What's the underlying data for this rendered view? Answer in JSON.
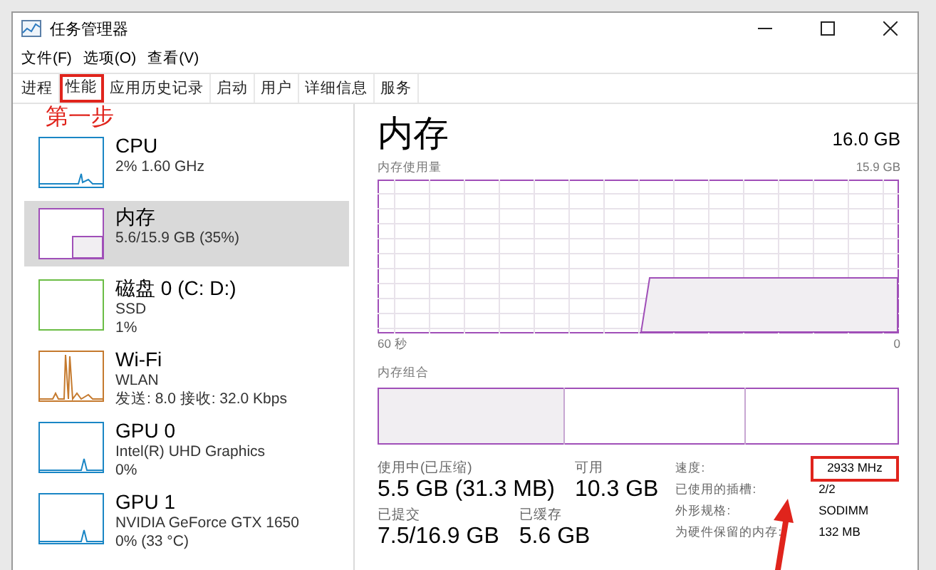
{
  "window": {
    "title": "任务管理器"
  },
  "menu": [
    "文件(F)",
    "选项(O)",
    "查看(V)"
  ],
  "tabs": [
    {
      "label": "进程",
      "selected": false,
      "boxed": false
    },
    {
      "label": "性能",
      "selected": true,
      "boxed": true
    },
    {
      "label": "应用历史记录",
      "selected": false,
      "boxed": false
    },
    {
      "label": "启动",
      "selected": false,
      "boxed": false
    },
    {
      "label": "用户",
      "selected": false,
      "boxed": false
    },
    {
      "label": "详细信息",
      "selected": false,
      "boxed": false
    },
    {
      "label": "服务",
      "selected": false,
      "boxed": false
    }
  ],
  "annotation": {
    "step_label": "第一步"
  },
  "sidebar": {
    "items": [
      {
        "kind": "cpu",
        "name": "CPU",
        "lines": [
          "2% 1.60 GHz"
        ],
        "color": "#1a86c5",
        "selected": false
      },
      {
        "kind": "memory",
        "name": "内存",
        "lines": [
          "5.6/15.9 GB (35%)"
        ],
        "color": "#a04fb8",
        "selected": true
      },
      {
        "kind": "disk",
        "name": "磁盘 0 (C: D:)",
        "lines": [
          "SSD",
          "1%"
        ],
        "color": "#6bbd45",
        "selected": false
      },
      {
        "kind": "network",
        "name": "Wi-Fi",
        "lines": [
          "WLAN",
          "发送: 8.0 接收: 32.0 Kbps"
        ],
        "color": "#c57a2e",
        "selected": false
      },
      {
        "kind": "gpu",
        "name": "GPU 0",
        "lines": [
          "Intel(R) UHD Graphics",
          "0%"
        ],
        "color": "#1a86c5",
        "selected": false
      },
      {
        "kind": "gpu",
        "name": "GPU 1",
        "lines": [
          "NVIDIA GeForce GTX 1650",
          "0% (33 °C)"
        ],
        "color": "#1a86c5",
        "selected": false
      }
    ]
  },
  "detail": {
    "title": "内存",
    "total": "16.0 GB",
    "usage_label": "内存使用量",
    "usage_max": "15.9 GB",
    "time_start": "60 秒",
    "time_end": "0",
    "composition_label": "内存组合",
    "stats": [
      [
        {
          "label": "使用中(已压缩)",
          "value": "5.5 GB (31.3 MB)"
        },
        {
          "label": "可用",
          "value": "10.3 GB"
        }
      ],
      [
        {
          "label": "已提交",
          "value": "7.5/16.9 GB"
        },
        {
          "label": "已缓存",
          "value": "5.6 GB"
        }
      ]
    ],
    "specs": [
      {
        "label": "速度:",
        "value": "2933 MHz",
        "boxed": true
      },
      {
        "label": "已使用的插槽:",
        "value": "2/2",
        "boxed": false
      },
      {
        "label": "外形规格:",
        "value": "SODIMM",
        "boxed": false
      },
      {
        "label": "为硬件保留的内存:",
        "value": "132 MB",
        "boxed": false
      }
    ]
  }
}
